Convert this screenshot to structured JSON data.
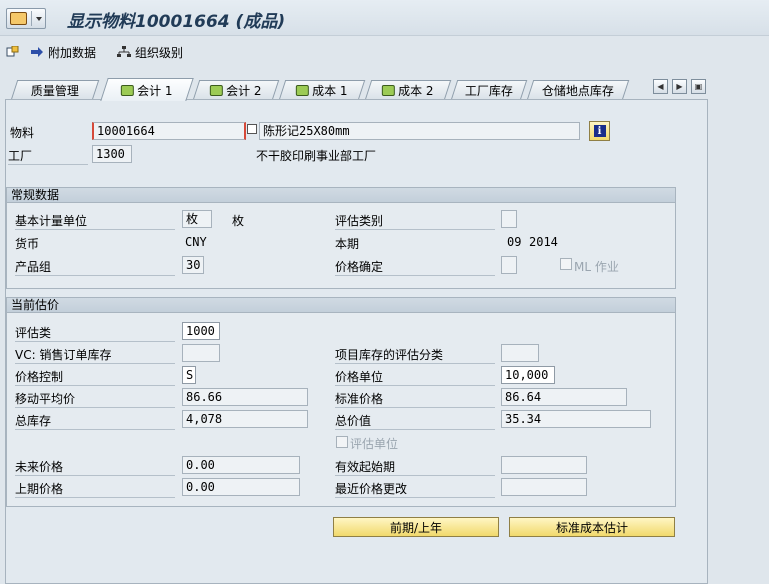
{
  "header": {
    "title": "显示物料10001664 (成品)"
  },
  "toolbar": {
    "additional_data": "附加数据",
    "org_levels": "组织级别"
  },
  "tabs": [
    {
      "label": "质量管理",
      "icon": false
    },
    {
      "label": "会计 1",
      "icon": true,
      "active": true
    },
    {
      "label": "会计 2",
      "icon": true
    },
    {
      "label": "成本 1",
      "icon": true
    },
    {
      "label": "成本 2",
      "icon": true
    },
    {
      "label": "工厂库存",
      "icon": false
    },
    {
      "label": "仓储地点库存",
      "icon": false
    }
  ],
  "header_fields": {
    "material_label": "物料",
    "material_value": "10001664",
    "material_desc": "陈形记25X80mm",
    "plant_label": "工厂",
    "plant_value": "1300",
    "plant_desc": "不干胶印刷事业部工厂"
  },
  "general": {
    "title": "常规数据",
    "base_uom_label": "基本计量单位",
    "base_uom_value": "枚",
    "base_uom_text": "枚",
    "valuation_cat_label": "评估类别",
    "valuation_cat_value": "",
    "currency_label": "货币",
    "currency_value": "CNY",
    "period_label": "本期",
    "period_month": "09",
    "period_year": "2014",
    "division_label": "产品组",
    "division_value": "30",
    "price_det_label": "价格确定",
    "price_det_value": "",
    "ml_label": "ML 作业"
  },
  "valuation": {
    "title": "当前估价",
    "val_class_label": "评估类",
    "val_class_value": "1000",
    "vc_sales_label": "VC: 销售订单库存",
    "vc_sales_value": "",
    "proj_stock_label": "项目库存的评估分类",
    "proj_stock_value": "",
    "price_control_label": "价格控制",
    "price_control_value": "S",
    "price_unit_label": "价格单位",
    "price_unit_value": "10,000",
    "mov_avg_label": "移动平均价",
    "mov_avg_value": "86.66",
    "std_price_label": "标准价格",
    "std_price_value": "86.64",
    "total_stock_label": "总库存",
    "total_stock_value": "4,078",
    "total_value_label": "总价值",
    "total_value_value": "35.34",
    "val_unit_label": "评估单位",
    "future_price_label": "未来价格",
    "future_price_value": "0.00",
    "valid_from_label": "有效起始期",
    "valid_from_value": "",
    "prev_price_label": "上期价格",
    "prev_price_value": "0.00",
    "last_change_label": "最近价格更改",
    "last_change_value": ""
  },
  "buttons": {
    "prev_period": "前期/上年",
    "std_cost_est": "标准成本估计"
  }
}
